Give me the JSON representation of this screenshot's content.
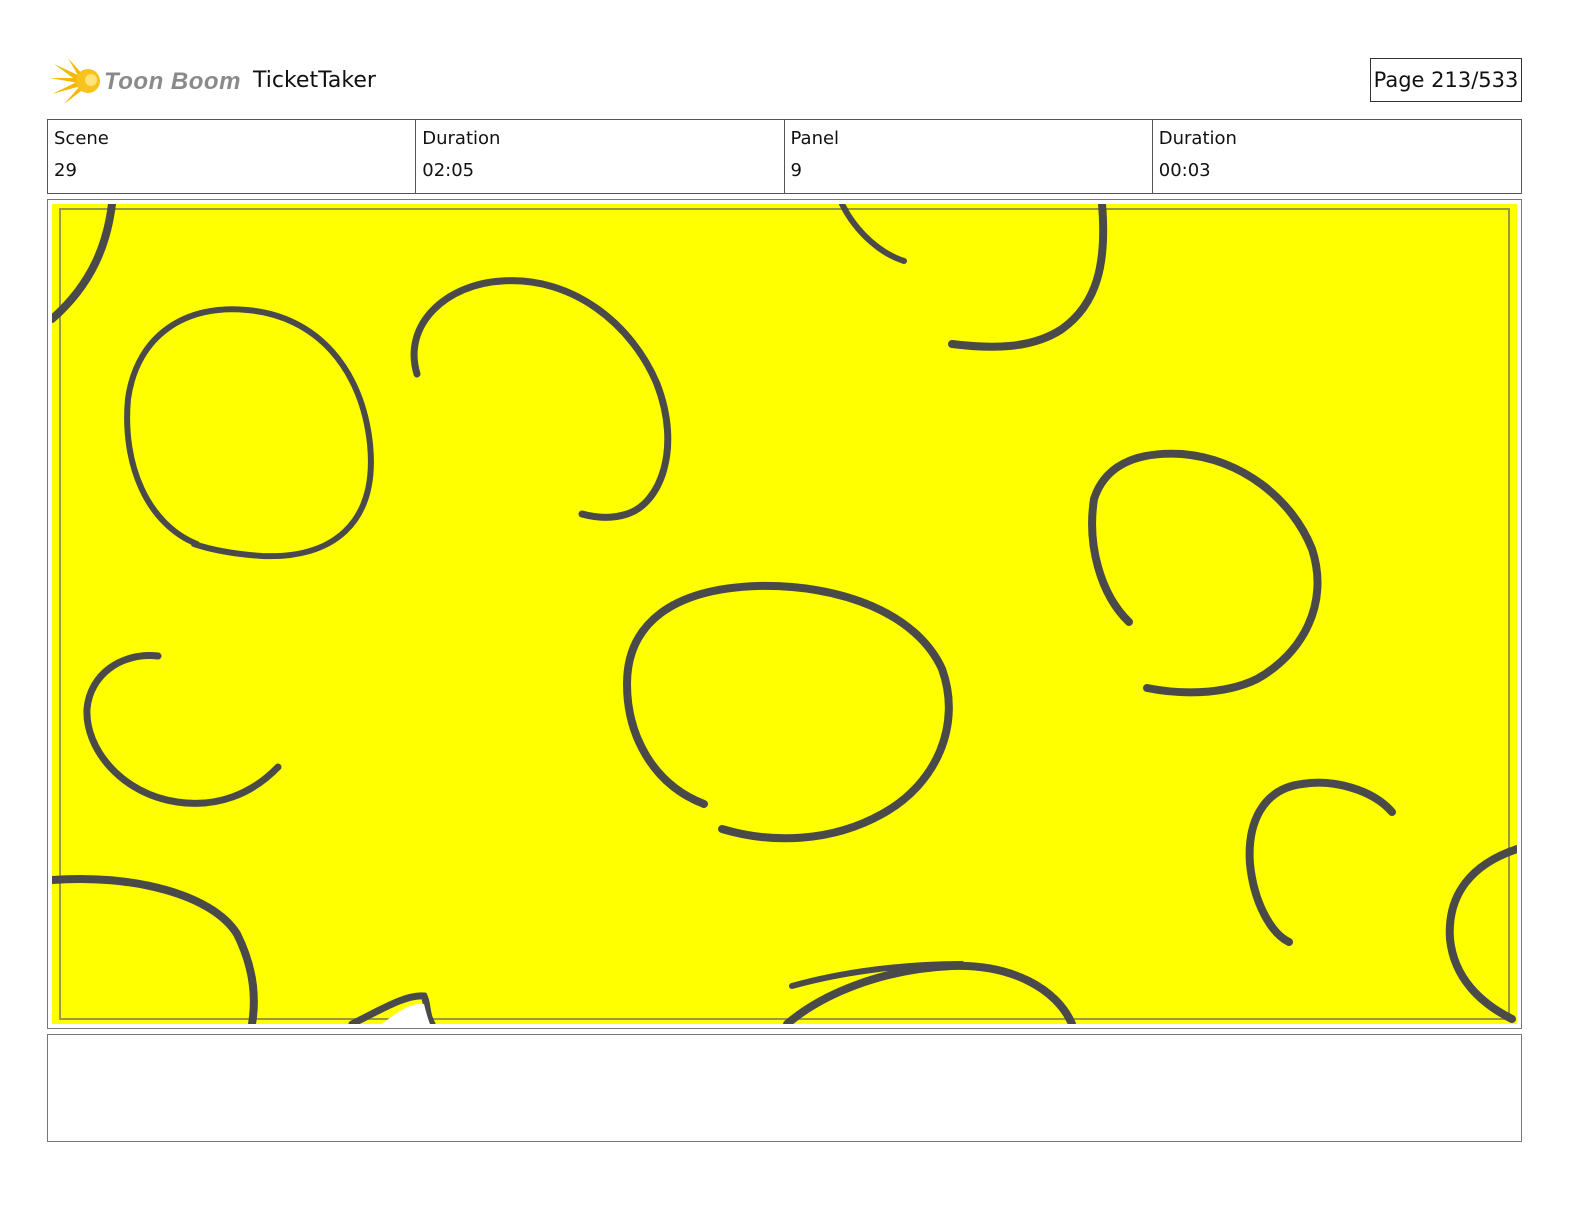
{
  "header": {
    "brand": "Toon Boom",
    "project_title": "TicketTaker",
    "page_label": "Page 213/533"
  },
  "info": {
    "scene_label": "Scene",
    "scene_value": "29",
    "scene_duration_label": "Duration",
    "scene_duration_value": "02:05",
    "panel_label": "Panel",
    "panel_value": "9",
    "panel_duration_label": "Duration",
    "panel_duration_value": "00:03"
  },
  "panel": {
    "background_color": "#ffff00",
    "stroke_color": "#4a4a4a",
    "safe_frame_color": "#9a9a3a"
  },
  "notes": {
    "text": ""
  }
}
